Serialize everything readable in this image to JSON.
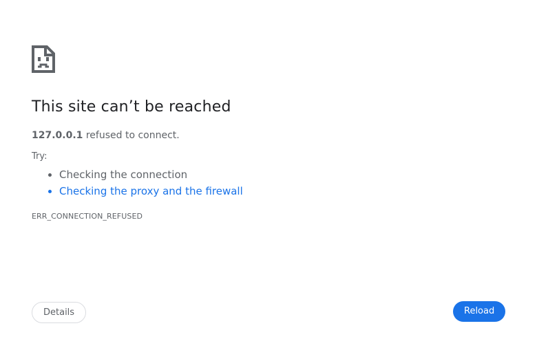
{
  "error": {
    "icon": "sad-document-icon",
    "title": "This site can’t be reached",
    "host": "127.0.0.1",
    "summary_suffix": " refused to connect.",
    "try_label": "Try:",
    "suggestions": [
      {
        "label": "Checking the connection",
        "is_link": false
      },
      {
        "label": "Checking the proxy and the firewall",
        "is_link": true
      }
    ],
    "code": "ERR_CONNECTION_REFUSED"
  },
  "buttons": {
    "details_label": "Details",
    "reload_label": "Reload"
  },
  "colors": {
    "link": "#1a73e8",
    "primary_button": "#1a73e8",
    "text": "#5f6368",
    "title": "#202124"
  }
}
